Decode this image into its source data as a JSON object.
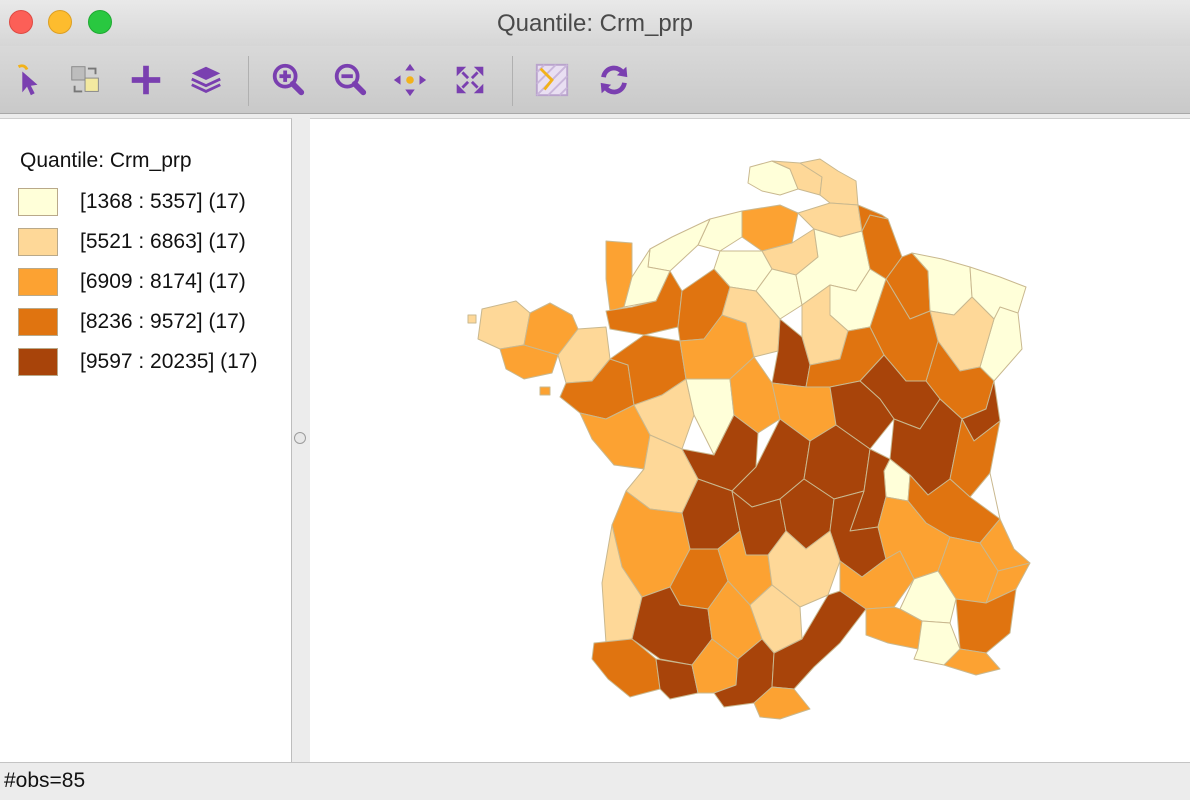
{
  "window": {
    "title": "Quantile: Crm_prp"
  },
  "toolbar": {
    "buttons": [
      {
        "name": "select-icon"
      },
      {
        "name": "selection-copy-icon"
      },
      {
        "name": "add-icon"
      },
      {
        "name": "layers-icon"
      },
      {
        "name": "zoom-in-icon"
      },
      {
        "name": "zoom-out-icon"
      },
      {
        "name": "pan-icon"
      },
      {
        "name": "full-extent-icon"
      },
      {
        "name": "basemap-icon"
      },
      {
        "name": "refresh-icon"
      }
    ],
    "icon_color": "#7a3fb0"
  },
  "legend": {
    "title": "Quantile: Crm_prp",
    "items": [
      {
        "label": "[1368 : 5357] (17)",
        "color": "#ffffd9"
      },
      {
        "label": "[5521 : 6863] (17)",
        "color": "#fed898"
      },
      {
        "label": "[6909 : 8174] (17)",
        "color": "#fca232"
      },
      {
        "label": "[8236 : 9572] (17)",
        "color": "#e07410"
      },
      {
        "label": "[9597 : 20235] (17)",
        "color": "#a8440a"
      }
    ]
  },
  "map": {
    "observations": 85
  },
  "status": {
    "text": "#obs=85"
  }
}
